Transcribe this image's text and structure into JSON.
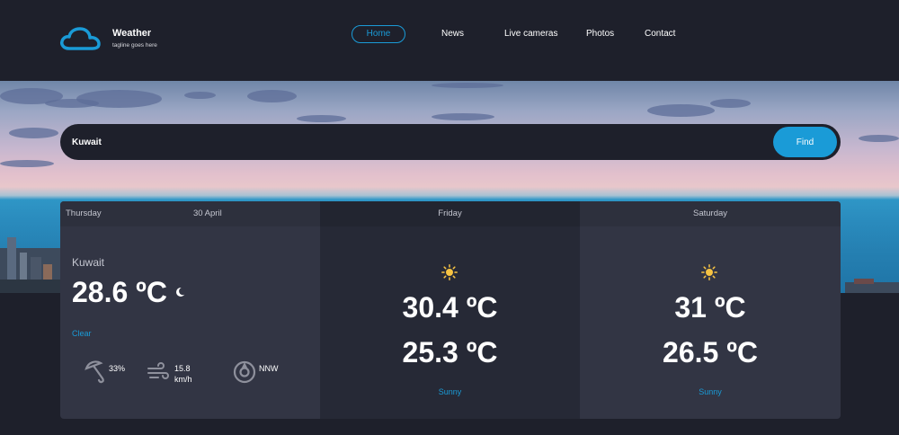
{
  "brand": {
    "title": "Weather",
    "tagline": "tagline goes here"
  },
  "nav": [
    {
      "label": "Home",
      "active": true
    },
    {
      "label": "News",
      "active": false
    },
    {
      "label": "Live cameras",
      "active": false
    },
    {
      "label": "Photos",
      "active": false
    },
    {
      "label": "Contact",
      "active": false
    }
  ],
  "search": {
    "value": "Kuwait",
    "button_label": "Find"
  },
  "today": {
    "day": "Thursday",
    "date": "30 April",
    "location": "Kuwait",
    "temperature": "28.6 ºC",
    "condition_icon": "moon-icon",
    "condition": "Clear",
    "humidity": "33%",
    "wind_speed_value": "15.8",
    "wind_speed_unit": "km/h",
    "wind_direction": "NNW"
  },
  "forecast": [
    {
      "day": "Friday",
      "icon": "sun-icon",
      "high": "30.4 ºC",
      "low": "25.3 ºC",
      "condition": "Sunny"
    },
    {
      "day": "Saturday",
      "icon": "sun-icon",
      "high": "31 ºC",
      "low": "26.5 ºC",
      "condition": "Sunny"
    }
  ],
  "colors": {
    "accent": "#1a9bd7",
    "background": "#1e202b",
    "panel": "#323544",
    "panel_alt": "#262936"
  }
}
